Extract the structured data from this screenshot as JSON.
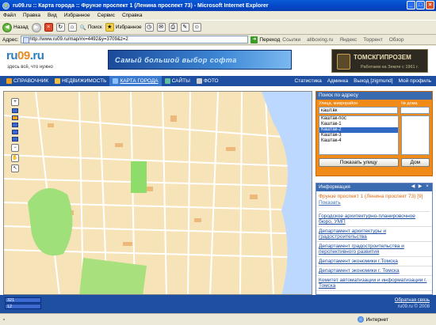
{
  "window": {
    "title": "ru09.ru :: Карта города :: Фрунзе проспект 1 (Ленина проспект 73) - Microsoft Internet Explorer"
  },
  "menu": [
    "Файл",
    "Правка",
    "Вид",
    "Избранное",
    "Сервис",
    "Справка"
  ],
  "toolbar": {
    "back": "Назад",
    "search": "Поиск",
    "favorites": "Избранное"
  },
  "address": {
    "label": "Адрес:",
    "url": "http://www.ru09.ru/map/#x=4492&y=3709&z=2",
    "go": "Переход",
    "links_label": "Ссылки",
    "links": [
      "allboxing.ru",
      "Яндекс",
      "Торрент",
      "Обзор"
    ]
  },
  "site": {
    "logo_main": "ru",
    "logo_o": "09",
    "logo_tld": ".ru",
    "slogan": "здесь всё, что нужно",
    "banner1": "Самый большой выбор софта",
    "banner2_title": "ТОМСКГИПРОЗЕМ",
    "banner2_sub": "Работаем на Земле с 1961 г.",
    "nav": [
      "СПРАВОЧНИК",
      "НЕДВИЖИМОСТЬ",
      "КАРТА ГОРОДА",
      "САЙТЫ",
      "ФОТО"
    ],
    "nav_active": 2,
    "nav_right": [
      "Статистика",
      "Админка",
      "Выход [zigmund]",
      "Мой профиль"
    ]
  },
  "search": {
    "title": "Поиск по адресу",
    "street_label": "Улица, микрорайон",
    "house_label": "№ дома",
    "street_value": "кашт.вк",
    "house_value": "",
    "options": [
      "Каштак-пос",
      "Каштак-1",
      "Каштак-2",
      "Каштак-3",
      "Каштак-4"
    ],
    "selected": 2,
    "show_street": "Показать улицу",
    "house_btn": "Дом"
  },
  "info": {
    "title": "Информация",
    "address": "Фрунзе проспект 1 (Ленина проспект 73)",
    "count": "[9]",
    "show": "Показать",
    "orgs": [
      "Городское архитектурно-планировочное бюро, УМП",
      "Департамент архитектуры и градостроительства",
      "Департамент градостроительства и перспективного развития",
      "Департамент экономики г.Томска",
      "Департамент экономики г. Томска",
      "Комитет автоматизации и информатизации г. Томска"
    ]
  },
  "coords": {
    "x": "321",
    "y": "12"
  },
  "footer": {
    "feedback": "Обратная связь",
    "copyright": "ru09.ru © 2008"
  },
  "status": {
    "zone": "Интернет"
  },
  "colors": {
    "navbar": "#1e4fa0",
    "accent": "#f08a18",
    "map_bg": "#f7e3b8"
  }
}
